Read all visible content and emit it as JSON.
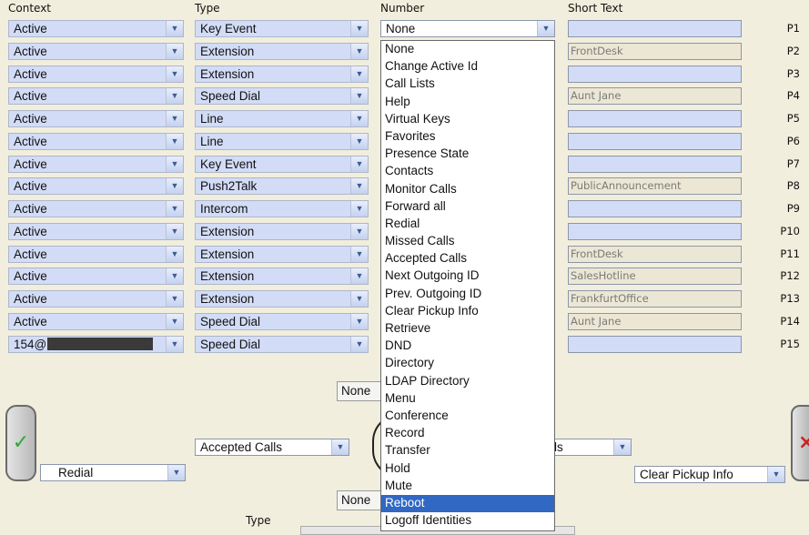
{
  "headers": {
    "context": "Context",
    "type": "Type",
    "number": "Number",
    "short_text": "Short Text"
  },
  "rows": [
    {
      "context": "Active",
      "type": "Key Event",
      "number": "None",
      "short": "",
      "key": "P1"
    },
    {
      "context": "Active",
      "type": "Extension",
      "number": "",
      "short": "FrontDesk",
      "key": "P2"
    },
    {
      "context": "Active",
      "type": "Extension",
      "number": "",
      "short": "",
      "key": "P3"
    },
    {
      "context": "Active",
      "type": "Speed Dial",
      "number": "",
      "short": "Aunt Jane",
      "key": "P4"
    },
    {
      "context": "Active",
      "type": "Line",
      "number": "",
      "short": "",
      "key": "P5"
    },
    {
      "context": "Active",
      "type": "Line",
      "number": "",
      "short": "",
      "key": "P6"
    },
    {
      "context": "Active",
      "type": "Key Event",
      "number": "",
      "short": "",
      "key": "P7"
    },
    {
      "context": "Active",
      "type": "Push2Talk",
      "number": "",
      "short": "PublicAnnouncement",
      "key": "P8"
    },
    {
      "context": "Active",
      "type": "Intercom",
      "number": "",
      "short": "",
      "key": "P9"
    },
    {
      "context": "Active",
      "type": "Extension",
      "number": "",
      "short": "",
      "key": "P10"
    },
    {
      "context": "Active",
      "type": "Extension",
      "number": "",
      "short": "FrontDesk",
      "key": "P11"
    },
    {
      "context": "Active",
      "type": "Extension",
      "number": "",
      "short": "SalesHotline",
      "key": "P12"
    },
    {
      "context": "Active",
      "type": "Extension",
      "number": "",
      "short": "FrankfurtOffice",
      "key": "P13"
    },
    {
      "context": "Active",
      "type": "Speed Dial",
      "number": "",
      "short": "Aunt Jane",
      "key": "P14"
    },
    {
      "context": "154@",
      "type": "Speed Dial",
      "number": "",
      "short": "",
      "key": "P15"
    }
  ],
  "dropdown": {
    "options": [
      "None",
      "Change Active Id",
      "Call Lists",
      "Help",
      "Virtual Keys",
      "Favorites",
      "Presence State",
      "Contacts",
      "Monitor Calls",
      "Forward all",
      "Redial",
      "Missed Calls",
      "Accepted Calls",
      "Next Outgoing ID",
      "Prev. Outgoing ID",
      "Clear Pickup Info",
      "Retrieve",
      "DND",
      "Directory",
      "LDAP Directory",
      "Menu",
      "Conference",
      "Record",
      "Transfer",
      "Hold",
      "Mute",
      "Reboot",
      "Logoff Identities"
    ],
    "highlighted": "Reboot"
  },
  "lower": {
    "none_top": "None",
    "none_bottom": "None",
    "accepted_select": "Accepted Calls",
    "redial_select": "Redial",
    "partial_select": "ls",
    "clear_pickup_select": "Clear Pickup Info",
    "type_label": "Type",
    "left_key_glyph": "✓",
    "right_key_glyph": "×"
  },
  "colors": {
    "row_field": "#d2dcf6",
    "highlight": "#3168c4",
    "background": "#f2eedd",
    "ok": "#2fa83b",
    "cancel": "#cc2222"
  }
}
